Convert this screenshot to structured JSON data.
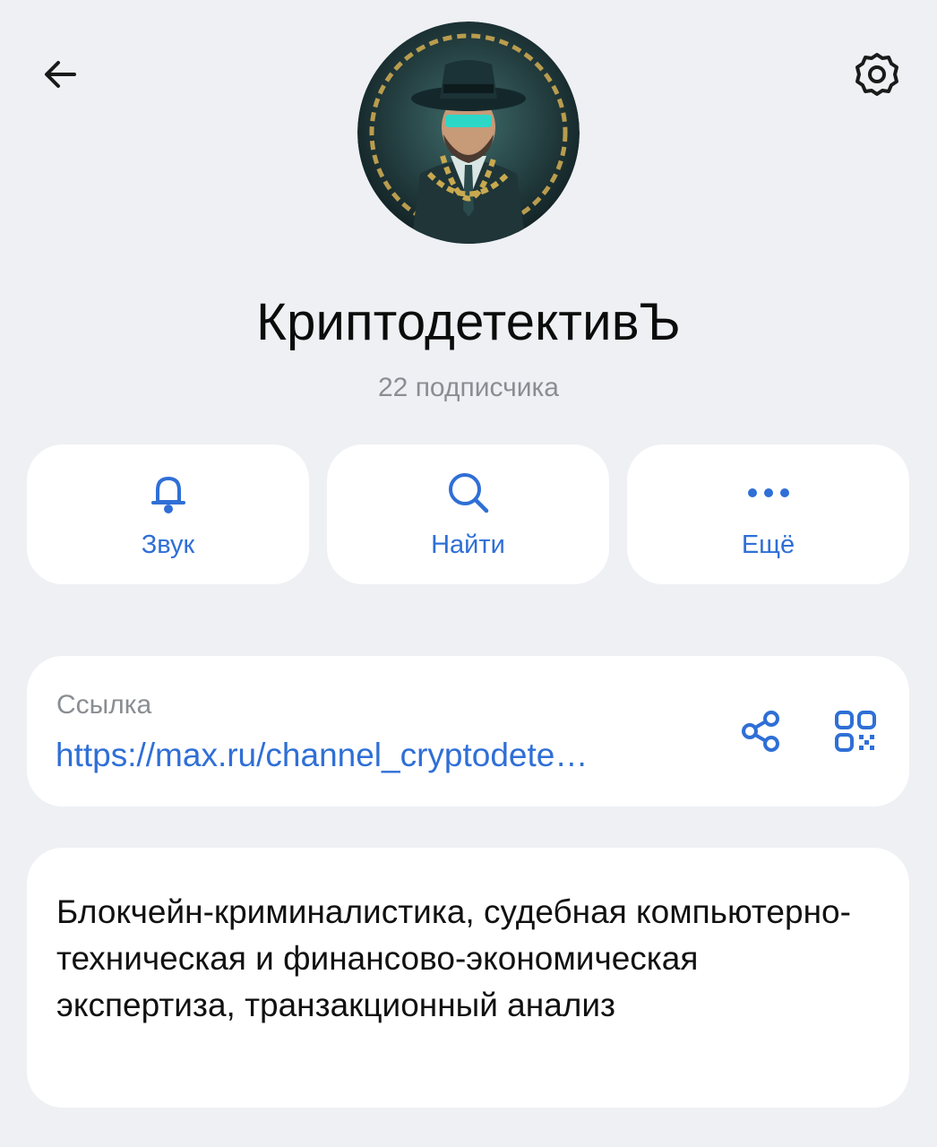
{
  "header": {
    "back_icon": "arrow-left-icon",
    "settings_icon": "gear-icon"
  },
  "channel": {
    "title": "КриптодетективЪ",
    "subscribers": "22 подписчика",
    "avatar": "detective-avatar"
  },
  "actions": [
    {
      "label": "Звук",
      "icon": "bell-icon"
    },
    {
      "label": "Найти",
      "icon": "search-icon"
    },
    {
      "label": "Ещё",
      "icon": "more-dots-icon"
    }
  ],
  "link": {
    "caption": "Ссылка",
    "url": "https://max.ru/channel_cryptodete…",
    "share_icon": "share-icon",
    "qr_icon": "qr-code-icon"
  },
  "description": {
    "text": "Блокчейн-криминалистика, судебная компьютерно-техническая и финансово-экономическая экспертиза, транзакционный анализ"
  },
  "colors": {
    "background": "#eef0f4",
    "card": "#ffffff",
    "accent": "#2f6fd6",
    "muted": "#8a8d92"
  }
}
